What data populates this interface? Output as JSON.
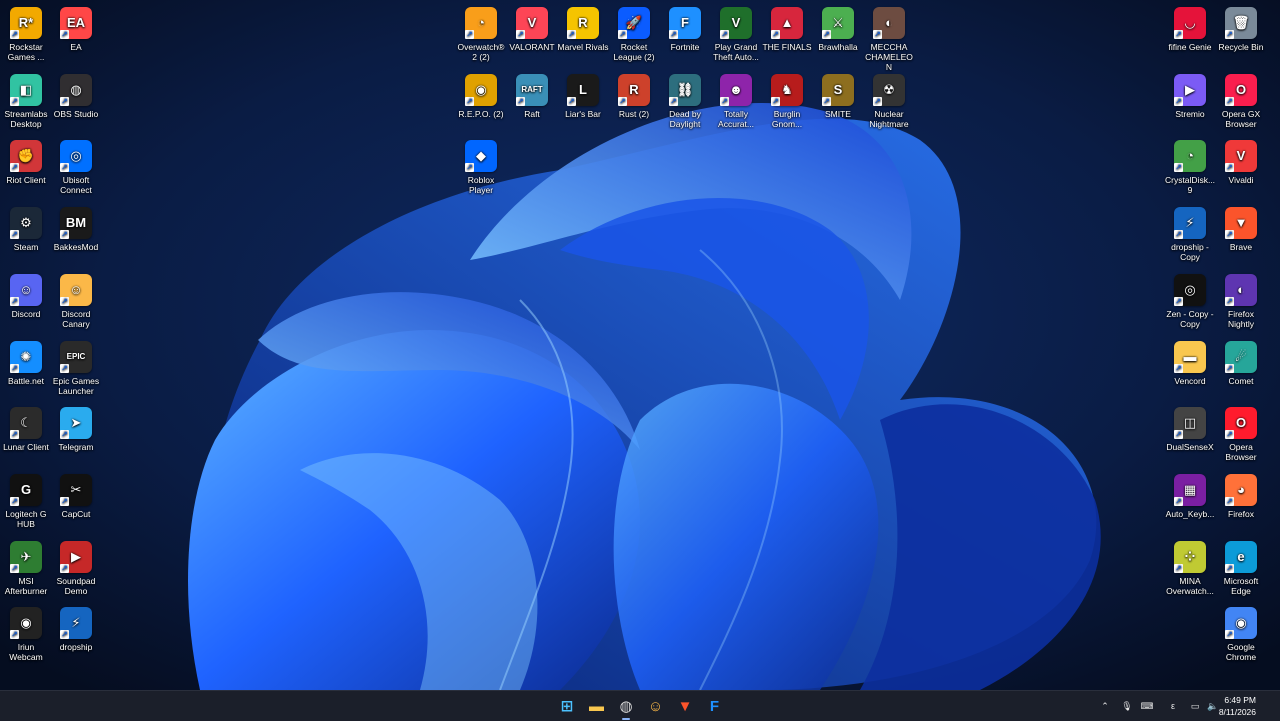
{
  "desktop": {
    "left_column_1": [
      {
        "label": "Rockstar Games ...",
        "glyph": "R*",
        "color": "#f2a900"
      },
      {
        "label": "Streamlabs Desktop",
        "glyph": "◧",
        "color": "#31c3a2"
      },
      {
        "label": "Riot Client",
        "glyph": "✊",
        "color": "#d13639"
      },
      {
        "label": "Steam",
        "glyph": "⚙",
        "color": "#1b2838"
      },
      {
        "label": "Discord",
        "glyph": "☺",
        "color": "#5865f2"
      },
      {
        "label": "Battle.net",
        "glyph": "✺",
        "color": "#148eff"
      },
      {
        "label": "Lunar Client",
        "glyph": "☾",
        "color": "#2b2b2b"
      },
      {
        "label": "Logitech G HUB",
        "glyph": "G",
        "color": "#111111"
      },
      {
        "label": "MSI Afterburner",
        "glyph": "✈",
        "color": "#2e7d32"
      },
      {
        "label": "Iriun Webcam",
        "glyph": "◉",
        "color": "#222222"
      }
    ],
    "left_column_2": [
      {
        "label": "EA",
        "glyph": "EA",
        "color": "#ff4747"
      },
      {
        "label": "OBS Studio",
        "glyph": "◍",
        "color": "#302e31"
      },
      {
        "label": "Ubisoft Connect",
        "glyph": "◎",
        "color": "#0070ff"
      },
      {
        "label": "BakkesMod",
        "glyph": "BM",
        "color": "#1a1a1a"
      },
      {
        "label": "Discord Canary",
        "glyph": "☺",
        "color": "#fbb848"
      },
      {
        "label": "Epic Games Launcher",
        "glyph": "EPIC",
        "color": "#2a2a2a"
      },
      {
        "label": "Telegram",
        "glyph": "➤",
        "color": "#2aabee"
      },
      {
        "label": "CapCut",
        "glyph": "✂",
        "color": "#111111"
      },
      {
        "label": "Soundpad Demo",
        "glyph": "▶",
        "color": "#c62828"
      },
      {
        "label": "dropship",
        "glyph": "⚡",
        "color": "#1565c0"
      }
    ],
    "top_row_1": [
      {
        "label": "Overwatch® 2 (2)",
        "glyph": "◔",
        "color": "#f99e1a"
      },
      {
        "label": "VALORANT",
        "glyph": "V",
        "color": "#fd4556"
      },
      {
        "label": "Marvel Rivals",
        "glyph": "R",
        "color": "#f5c400"
      },
      {
        "label": "Rocket League (2)",
        "glyph": "🚀",
        "color": "#0b5cff"
      },
      {
        "label": "Fortnite",
        "glyph": "F",
        "color": "#1e90ff"
      },
      {
        "label": "Play Grand Theft Auto...",
        "glyph": "V",
        "color": "#1f6f2b"
      },
      {
        "label": "THE FINALS",
        "glyph": "▲",
        "color": "#d7263d"
      },
      {
        "label": "Brawlhalla",
        "glyph": "⚔",
        "color": "#4caf50"
      },
      {
        "label": "MECCHA CHAMELEON",
        "glyph": "◐",
        "color": "#6d4c41"
      }
    ],
    "top_row_2": [
      {
        "label": "R.E.P.O. (2)",
        "glyph": "◉",
        "color": "#e0a100"
      },
      {
        "label": "Raft",
        "glyph": "RAFT",
        "color": "#3a8fb7"
      },
      {
        "label": "Liar's Bar",
        "glyph": "L",
        "color": "#1a1a1a"
      },
      {
        "label": "Rust (2)",
        "glyph": "R",
        "color": "#cd412b"
      },
      {
        "label": "Dead by Daylight",
        "glyph": "⛓",
        "color": "#2d6e7e"
      },
      {
        "label": "Totally Accurat...",
        "glyph": "☻",
        "color": "#8e24aa"
      },
      {
        "label": "Burglin Gnom...",
        "glyph": "♞",
        "color": "#b71c1c"
      },
      {
        "label": "SMITE",
        "glyph": "S",
        "color": "#8d6e1f"
      },
      {
        "label": "Nuclear Nightmare",
        "glyph": "☢",
        "color": "#333333"
      }
    ],
    "top_row_3": [
      {
        "label": "Roblox Player",
        "glyph": "◆",
        "color": "#0066ff"
      }
    ],
    "right_column_1": [
      {
        "label": "fifine Genie",
        "glyph": "◡",
        "color": "#e5133a"
      },
      {
        "label": "Stremio",
        "glyph": "▶",
        "color": "#7b5bf5"
      },
      {
        "label": "CrystalDisk... 9",
        "glyph": "◔",
        "color": "#43a047"
      },
      {
        "label": "dropship - Copy",
        "glyph": "⚡",
        "color": "#1565c0"
      },
      {
        "label": "Zen - Copy - Copy",
        "glyph": "◎",
        "color": "#111111"
      },
      {
        "label": "Vencord",
        "glyph": "▬",
        "color": "#f9c74f"
      },
      {
        "label": "DualSenseX",
        "glyph": "◫",
        "color": "#444444"
      },
      {
        "label": "Auto_Keyb...",
        "glyph": "▦",
        "color": "#7b1fa2"
      },
      {
        "label": "MINA Overwatch...",
        "glyph": "⁘",
        "color": "#c0ca33"
      }
    ],
    "right_column_2": [
      {
        "label": "Recycle Bin",
        "glyph": "🗑",
        "color": "#7a8a99"
      },
      {
        "label": "Opera GX Browser",
        "glyph": "O",
        "color": "#fa1e4e"
      },
      {
        "label": "Vivaldi",
        "glyph": "V",
        "color": "#ef3939"
      },
      {
        "label": "Brave",
        "glyph": "▼",
        "color": "#fb542b"
      },
      {
        "label": "Firefox Nightly",
        "glyph": "◐",
        "color": "#5e35b1"
      },
      {
        "label": "Comet",
        "glyph": "☄",
        "color": "#26a69a"
      },
      {
        "label": "Opera Browser",
        "glyph": "O",
        "color": "#ff1b2d"
      },
      {
        "label": "Firefox",
        "glyph": "◕",
        "color": "#ff7139"
      },
      {
        "label": "Microsoft Edge",
        "glyph": "e",
        "color": "#0c9bd8"
      },
      {
        "label": "Google Chrome",
        "glyph": "◉",
        "color": "#4285f4"
      }
    ]
  },
  "taskbar": {
    "apps": [
      {
        "name": "start-button",
        "glyph": "⊞",
        "color": "#4cc2ff",
        "active": false
      },
      {
        "name": "file-explorer",
        "glyph": "▬",
        "color": "#f9c74f",
        "active": false
      },
      {
        "name": "obs-studio",
        "glyph": "◍",
        "color": "#d9d9d9",
        "active": true
      },
      {
        "name": "discord-canary",
        "glyph": "☺",
        "color": "#fbb848",
        "active": false
      },
      {
        "name": "brave",
        "glyph": "▼",
        "color": "#fb542b",
        "active": false
      },
      {
        "name": "fortnite",
        "glyph": "F",
        "color": "#1e90ff",
        "active": false
      }
    ],
    "tray": {
      "chevron": "⌃",
      "mic": "🎙",
      "keyboard": "⌨",
      "lang": "ε",
      "network": "▭",
      "volume": "🔈"
    },
    "time": "6:49 PM",
    "date": "8/11/2026"
  }
}
